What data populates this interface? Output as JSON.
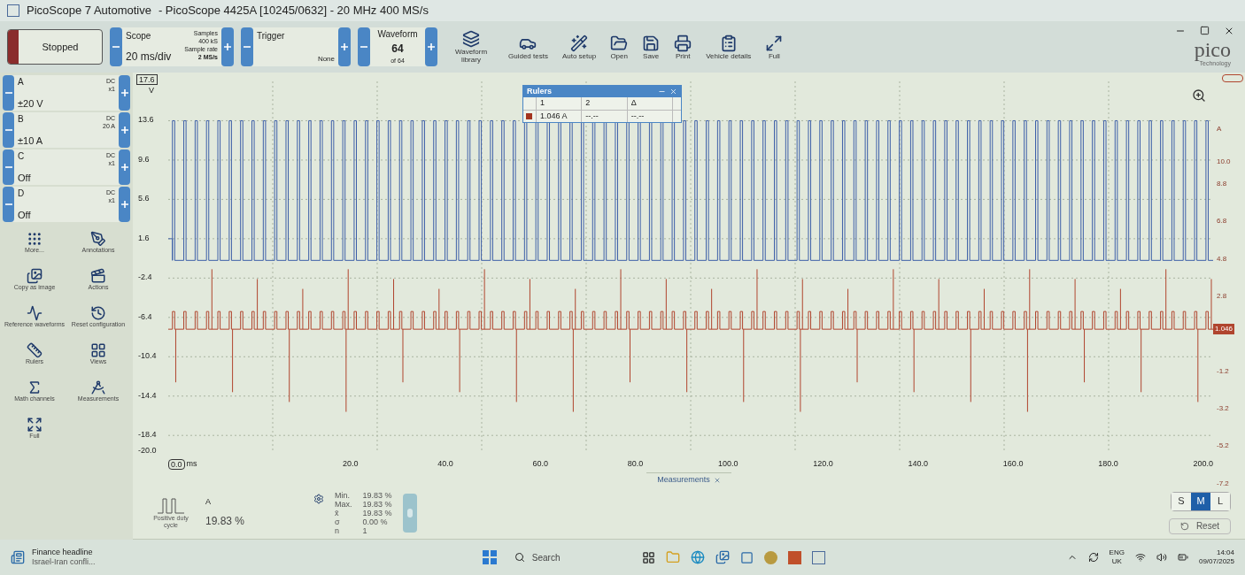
{
  "window": {
    "title": "PicoScope 7 Automotive",
    "subtitle": "- PicoScope 4425A [10245/0632] - 20 MHz 400 MS/s"
  },
  "run_button": {
    "label": "Stopped",
    "running": false
  },
  "scope": {
    "label": "Scope",
    "timebase": "20 ms/div",
    "samples_label": "Samples",
    "samples": "400 kS",
    "rate_label": "Sample rate",
    "rate": "2 MS/s"
  },
  "trigger": {
    "label": "Trigger",
    "mode": "None"
  },
  "waveform": {
    "label": "Waveform",
    "number": "64",
    "of": "of 64"
  },
  "toolbar": [
    "Waveform library",
    "Guided tests",
    "Auto setup",
    "Open",
    "Save",
    "Print",
    "Vehicle details",
    "Full"
  ],
  "logo": {
    "name": "pico",
    "tagline": "Technology"
  },
  "channels": [
    {
      "name": "A",
      "coupling": "DC",
      "probe": "x1",
      "range": "±20 V"
    },
    {
      "name": "B",
      "coupling": "DC",
      "probe": "20 A",
      "range": "±10 A"
    },
    {
      "name": "C",
      "coupling": "DC",
      "probe": "x1",
      "range": "Off"
    },
    {
      "name": "D",
      "coupling": "DC",
      "probe": "x1",
      "range": "Off"
    }
  ],
  "tools": [
    "More...",
    "Annotations",
    "Copy as image",
    "Actions",
    "Reference waveforms",
    "Reset configuration",
    "Rulers",
    "Views",
    "Math channels",
    "Measurements",
    "Full"
  ],
  "plot": {
    "left_axis": {
      "marker": "17.6",
      "unit": "V",
      "ticks": [
        "13.6",
        "9.6",
        "5.6",
        "1.6",
        "-2.4",
        "-6.4",
        "-10.4",
        "-14.4",
        "-18.4",
        "-20.0"
      ]
    },
    "right_axis": {
      "unit": "A",
      "marker": "1.046",
      "ticks": [
        "10.0",
        "8.8",
        "6.8",
        "4.8",
        "2.8",
        "-1.2",
        "-3.2",
        "-5.2",
        "-7.2"
      ]
    },
    "x_axis": {
      "marker": "0.0",
      "unit": "ms",
      "ticks": [
        "20.0",
        "40.0",
        "60.0",
        "80.0",
        "100.0",
        "120.0",
        "140.0",
        "160.0",
        "180.0",
        "200.0"
      ]
    }
  },
  "rulers": {
    "title": "Rulers",
    "columns": [
      "1",
      "2",
      "Δ"
    ],
    "rows": [
      {
        "color": "#a3341f",
        "values": [
          "1.046 A",
          "--.--",
          "--.--"
        ]
      }
    ]
  },
  "measurements_tab": "Measurements",
  "measurement": {
    "channel": "A",
    "name": "Positive duty cycle",
    "value": "19.83 %",
    "stats": [
      {
        "label": "Min.",
        "value": "19.83 %"
      },
      {
        "label": "Max.",
        "value": "19.83 %"
      },
      {
        "label": "x̄",
        "value": "19.83 %"
      },
      {
        "label": "σ",
        "value": "0.00 %"
      },
      {
        "label": "n",
        "value": "1"
      }
    ]
  },
  "size_buttons": [
    {
      "label": "S",
      "selected": false
    },
    {
      "label": "M",
      "selected": true
    },
    {
      "label": "L",
      "selected": false
    }
  ],
  "reset": "Reset",
  "taskbar": {
    "news_title": "Finance headline",
    "news_text": "Israel-Iran confli...",
    "search": "Search",
    "language": "ENG",
    "region": "UK",
    "time": "14:04",
    "date": "09/07/2025"
  }
}
